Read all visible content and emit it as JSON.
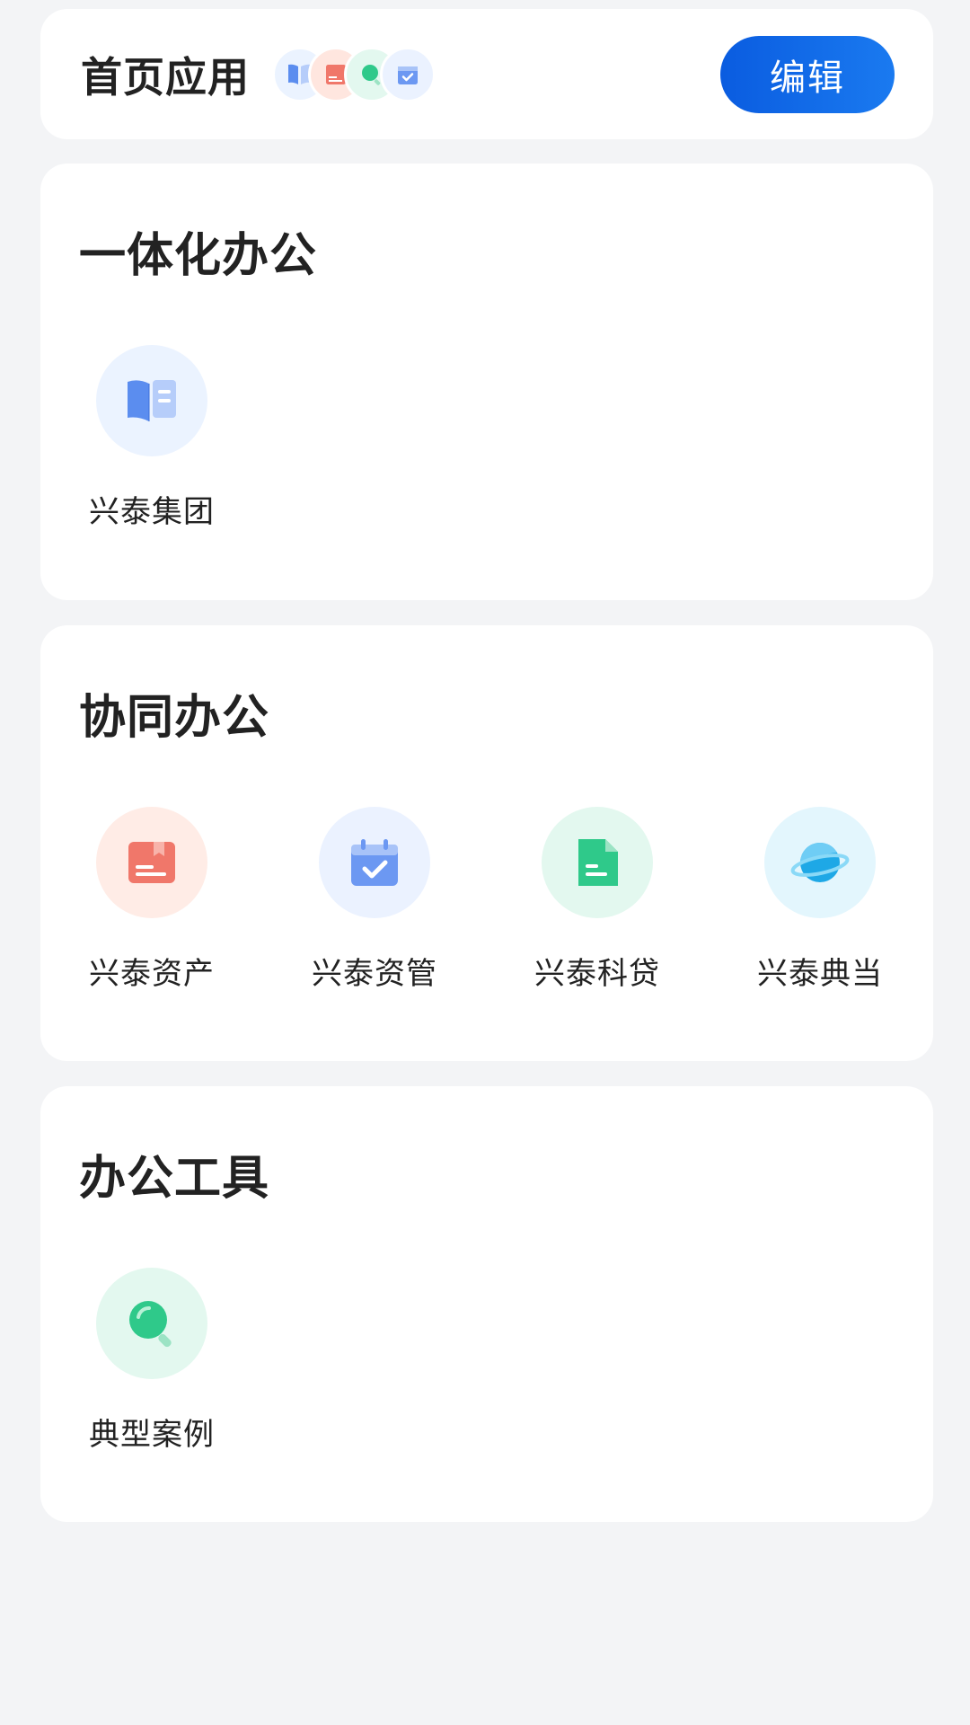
{
  "home_apps": {
    "title": "首页应用",
    "edit_label": "编辑",
    "stack_icons": [
      "book-icon",
      "archive-box-icon",
      "search-icon",
      "calendar-check-icon"
    ]
  },
  "sections": [
    {
      "title": "一体化办公",
      "apps": [
        {
          "label": "兴泰集团",
          "icon": "book-icon",
          "bg": "#ebf3ff"
        }
      ]
    },
    {
      "title": "协同办公",
      "apps": [
        {
          "label": "兴泰资产",
          "icon": "archive-box-icon",
          "bg": "#ffece6"
        },
        {
          "label": "兴泰资管",
          "icon": "calendar-check-icon",
          "bg": "#ebf2ff"
        },
        {
          "label": "兴泰科贷",
          "icon": "document-icon",
          "bg": "#e3f8ef"
        },
        {
          "label": "兴泰典当",
          "icon": "planet-icon",
          "bg": "#e3f6fd"
        }
      ]
    },
    {
      "title": "办公工具",
      "apps": [
        {
          "label": "典型案例",
          "icon": "search-icon",
          "bg": "#e3f8ef"
        }
      ]
    }
  ],
  "colors": {
    "accent": "#0d66e8",
    "page_bg": "#f3f4f6",
    "card_bg": "#ffffff"
  }
}
